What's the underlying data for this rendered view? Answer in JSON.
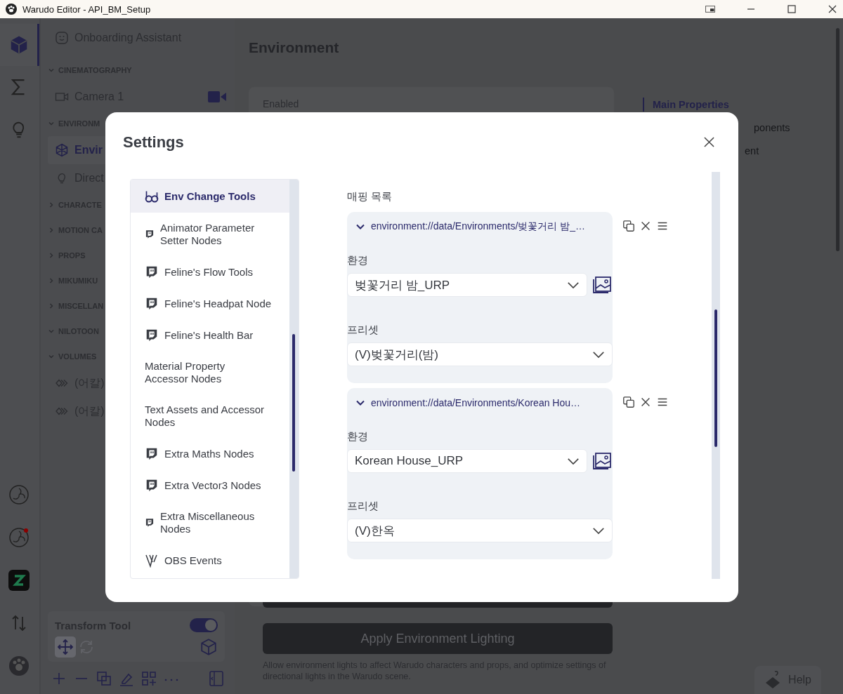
{
  "window": {
    "title": "Warudo Editor - API_BM_Setup"
  },
  "rail": [
    {
      "selected": true
    },
    {
      "selected": false
    },
    {
      "selected": false
    }
  ],
  "rail_bottom": [
    {
      "notification": false
    },
    {
      "notification": true
    },
    {
      "notification": false
    },
    {
      "notification": false
    },
    {
      "notification": false
    }
  ],
  "sidebar": {
    "assistant": "Onboarding Assistant",
    "sections": [
      {
        "title": "CINEMATOGRAPHY",
        "expanded": true,
        "items": [
          {
            "label": "Camera 1",
            "kind": "camera",
            "selected": false,
            "active": true
          }
        ]
      },
      {
        "title": "ENVIRONM",
        "expanded": true,
        "items": [
          {
            "label": "Envir",
            "kind": "environment",
            "selected": true
          },
          {
            "label": "Direct",
            "kind": "light",
            "selected": false
          }
        ]
      },
      {
        "title": "CHARACTE",
        "expanded": false
      },
      {
        "title": "MOTION CA",
        "expanded": false
      },
      {
        "title": "PROPS",
        "expanded": false
      },
      {
        "title": "MIKUMIKU",
        "expanded": false
      },
      {
        "title": "MISCELLAN",
        "expanded": false
      },
      {
        "title": "NILOTOON",
        "expanded": true
      },
      {
        "title": "VOLUMES",
        "expanded": true,
        "items": [
          {
            "label": "(어칼)",
            "kind": "volume",
            "selected": false
          },
          {
            "label": "(어칼)",
            "kind": "volume",
            "selected": false
          }
        ]
      }
    ]
  },
  "transform_tool": {
    "title": "Transform Tool",
    "on": true,
    "tools": [
      {
        "selected": true,
        "disabled": false
      },
      {
        "selected": false,
        "disabled": true
      }
    ]
  },
  "main": {
    "title": "Environment",
    "field": "Enabled",
    "nav": [
      {
        "label": "Main Properties",
        "selected": true
      },
      {
        "label": "ponents",
        "selected": false
      },
      {
        "label": "ent",
        "selected": false
      }
    ],
    "apply_button": "Apply Environment Lighting",
    "apply_note": "Allow environment lights to affect Warudo characters and props, and optimize settings of directional lights in the Warudo scene."
  },
  "help": "Help",
  "settings": {
    "title": "Settings",
    "categories": [
      {
        "label": "Env Change Tools",
        "kind": "bd",
        "selected": true
      },
      {
        "label": "Animator Parameter Setter Nodes",
        "kind": "twitch-small",
        "selected": false
      },
      {
        "label": "Feline's Flow Tools",
        "kind": "twitch",
        "selected": false
      },
      {
        "label": "Feline's Headpat Node",
        "kind": "twitch",
        "selected": false
      },
      {
        "label": "Feline's Health Bar",
        "kind": "twitch",
        "selected": false
      },
      {
        "label": "Material Property Accessor Nodes",
        "kind": "none",
        "selected": false
      },
      {
        "label": "Text Assets and Accessor Nodes",
        "kind": "none",
        "selected": false
      },
      {
        "label": "Extra Maths Nodes",
        "kind": "twitch",
        "selected": false
      },
      {
        "label": "Extra Vector3 Nodes",
        "kind": "twitch",
        "selected": false
      },
      {
        "label": "Extra Miscellaneous Nodes",
        "kind": "twitch-small",
        "selected": false
      },
      {
        "label": "OBS Events",
        "kind": "v",
        "selected": false
      }
    ],
    "mapping_label": "매핑 목록",
    "mappings": [
      {
        "path": "environment://data/Environments/벚꽃거리 밤_…",
        "expanded": true,
        "environment_label": "환경",
        "environment": "벚꽃거리 밤_URP",
        "preset_label": "프리셋",
        "preset": "(V)벚꽃거리(밤)"
      },
      {
        "path": "environment://data/Environments/Korean Hou…",
        "expanded": true,
        "environment_label": "환경",
        "environment": "Korean House_URP",
        "preset_label": "프리셋",
        "preset": "(V)한옥"
      }
    ]
  }
}
